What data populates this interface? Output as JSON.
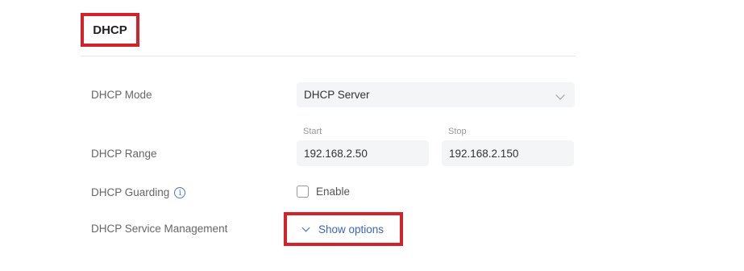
{
  "section": {
    "title": "DHCP"
  },
  "rows": {
    "mode": {
      "label": "DHCP Mode",
      "value": "DHCP Server"
    },
    "range": {
      "label": "DHCP Range",
      "start_label": "Start",
      "start_value": "192.168.2.50",
      "stop_label": "Stop",
      "stop_value": "192.168.2.150"
    },
    "guarding": {
      "label": "DHCP Guarding",
      "info_icon": "i",
      "checkbox_label": "Enable",
      "checked": false
    },
    "service": {
      "label": "DHCP Service Management",
      "link_label": "Show options"
    }
  },
  "colors": {
    "highlight": "#d2232a",
    "link": "#3b63c4",
    "field_bg": "#f4f5f7"
  }
}
